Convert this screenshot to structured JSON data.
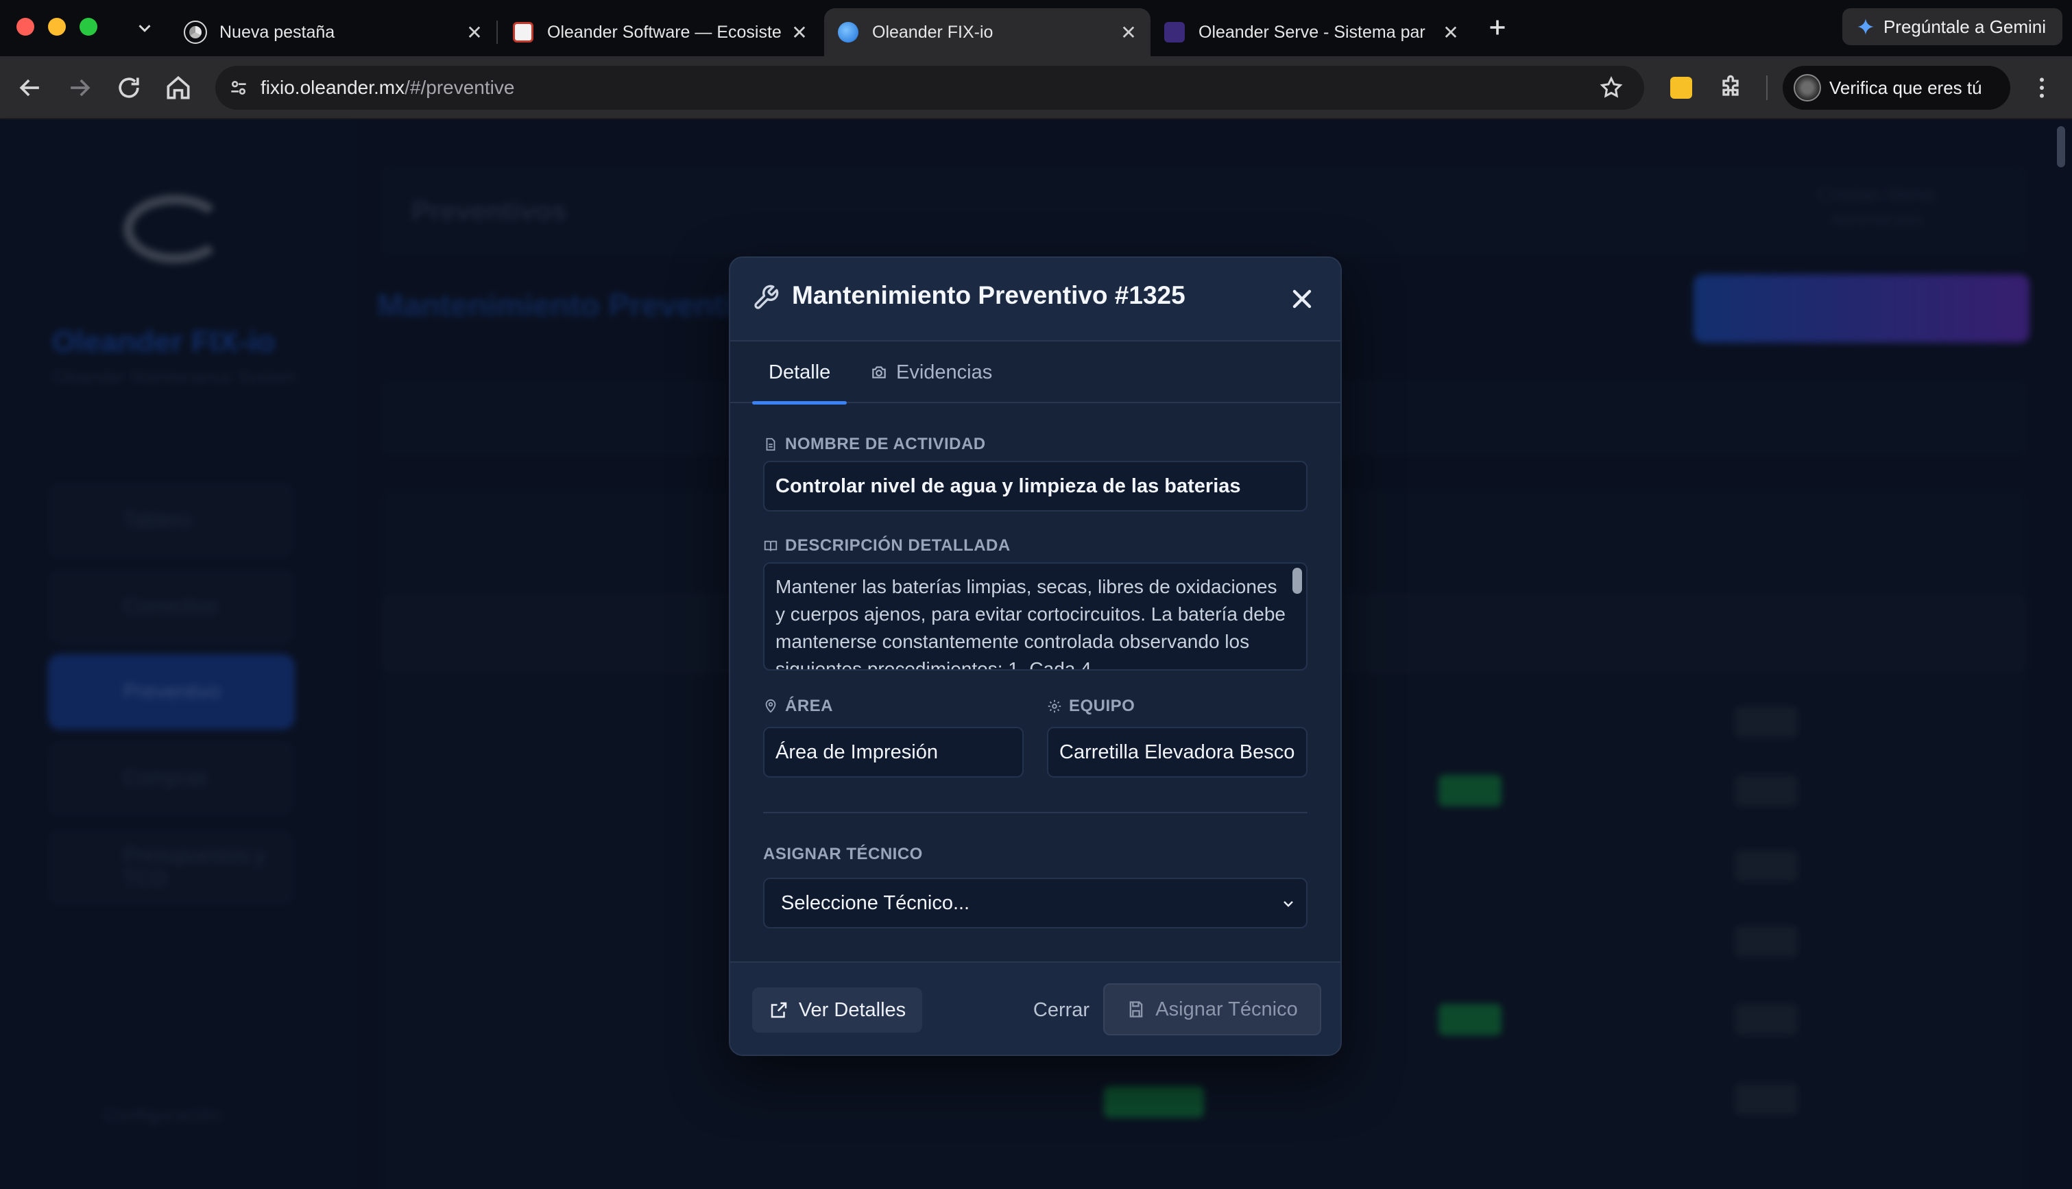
{
  "browser": {
    "tabs": [
      {
        "title": "Nueva pestaña",
        "active": false
      },
      {
        "title": "Oleander Software — Ecosiste",
        "active": false
      },
      {
        "title": "Oleander FIX-io",
        "active": true
      },
      {
        "title": "Oleander Serve - Sistema par",
        "active": false
      }
    ],
    "gemini_label": "Pregúntale a Gemini",
    "url_host": "fixio.oleander.mx",
    "url_path": "/#/preventive",
    "profile_label": "Verifica que eres tú"
  },
  "background_app": {
    "header_title": "Preventivos",
    "brand_name": "Oleander FIX-io",
    "brand_sub": "Oleander Maintenance System",
    "page_title": "Mantenimiento Preventivo",
    "new_plan_button": "+ Nuevo Plan Preventivo",
    "sidebar_items": [
      "Tablero",
      "Correctivo",
      "Preventivo",
      "Compras",
      "Presupuestos y TCO"
    ],
    "settings_label": "Configuración",
    "user_name": "Cristian Mena",
    "user_role": "Administrador"
  },
  "modal": {
    "title": "Mantenimiento Preventivo #1325",
    "tabs": {
      "detail": "Detalle",
      "evidence": "Evidencias"
    },
    "activity_label": "NOMBRE DE ACTIVIDAD",
    "activity_value": "Controlar nivel de agua y limpieza de las baterias",
    "description_label": "DESCRIPCIÓN DETALLADA",
    "description_value": "Mantener las baterías limpias, secas, libres de oxidaciones y cuerpos ajenos, para evitar cortocircuitos. La batería debe mantenerse constantemente controlada observando los siguientes procedimientos: 1. Cada 4",
    "area_label": "ÁREA",
    "area_value": "Área de Impresión",
    "equipment_label": "EQUIPO",
    "equipment_value": "Carretilla Elevadora Besco",
    "assign_label": "ASIGNAR TÉCNICO",
    "assign_placeholder": "Seleccione Técnico...",
    "footer": {
      "details_button": "Ver Detalles",
      "close_button": "Cerrar",
      "assign_button": "Asignar Técnico"
    }
  },
  "colors": {
    "accent": "#3b82f6",
    "modal_bg": "#172338",
    "page_bg": "#0f172a"
  }
}
